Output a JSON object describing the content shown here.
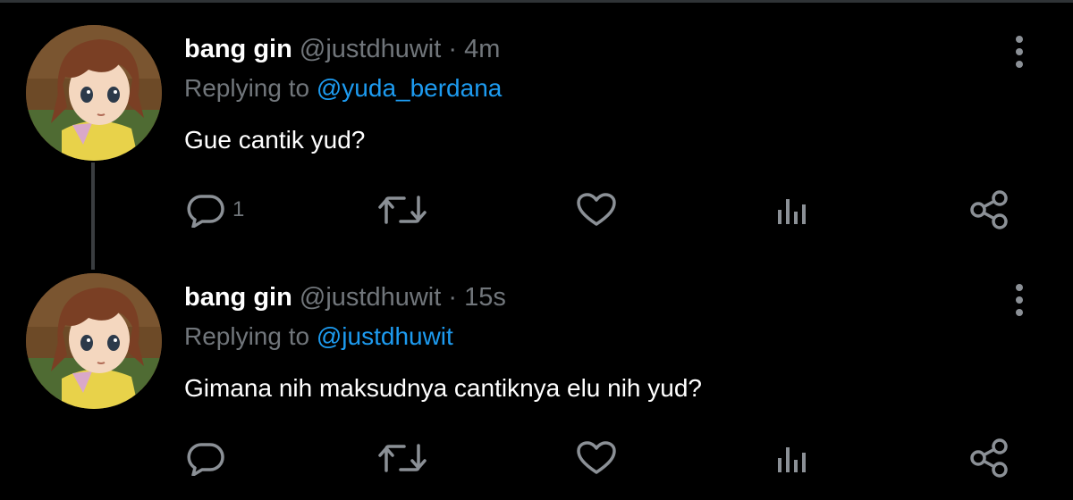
{
  "colors": {
    "background": "#000000",
    "text_primary": "#ffffff",
    "text_secondary": "#71767b",
    "mention": "#1d9bf0",
    "thread_line": "#3a3d40"
  },
  "tweets": [
    {
      "display_name": "bang gin",
      "handle": "@justdhuwit",
      "separator": "·",
      "time": "4m",
      "replying_prefix": "Replying to",
      "replying_to": "@yuda_berdana",
      "text": "Gue cantik yud?",
      "reply_count": "1",
      "icons": [
        "more-vertical-icon",
        "reply-icon",
        "retweet-icon",
        "like-icon",
        "views-icon",
        "share-icon"
      ]
    },
    {
      "display_name": "bang gin",
      "handle": "@justdhuwit",
      "separator": "·",
      "time": "15s",
      "replying_prefix": "Replying to",
      "replying_to": "@justdhuwit",
      "text": "Gimana nih maksudnya cantiknya elu nih yud?",
      "reply_count": "",
      "icons": [
        "more-vertical-icon",
        "reply-icon",
        "retweet-icon",
        "like-icon",
        "views-icon",
        "share-icon"
      ]
    }
  ]
}
